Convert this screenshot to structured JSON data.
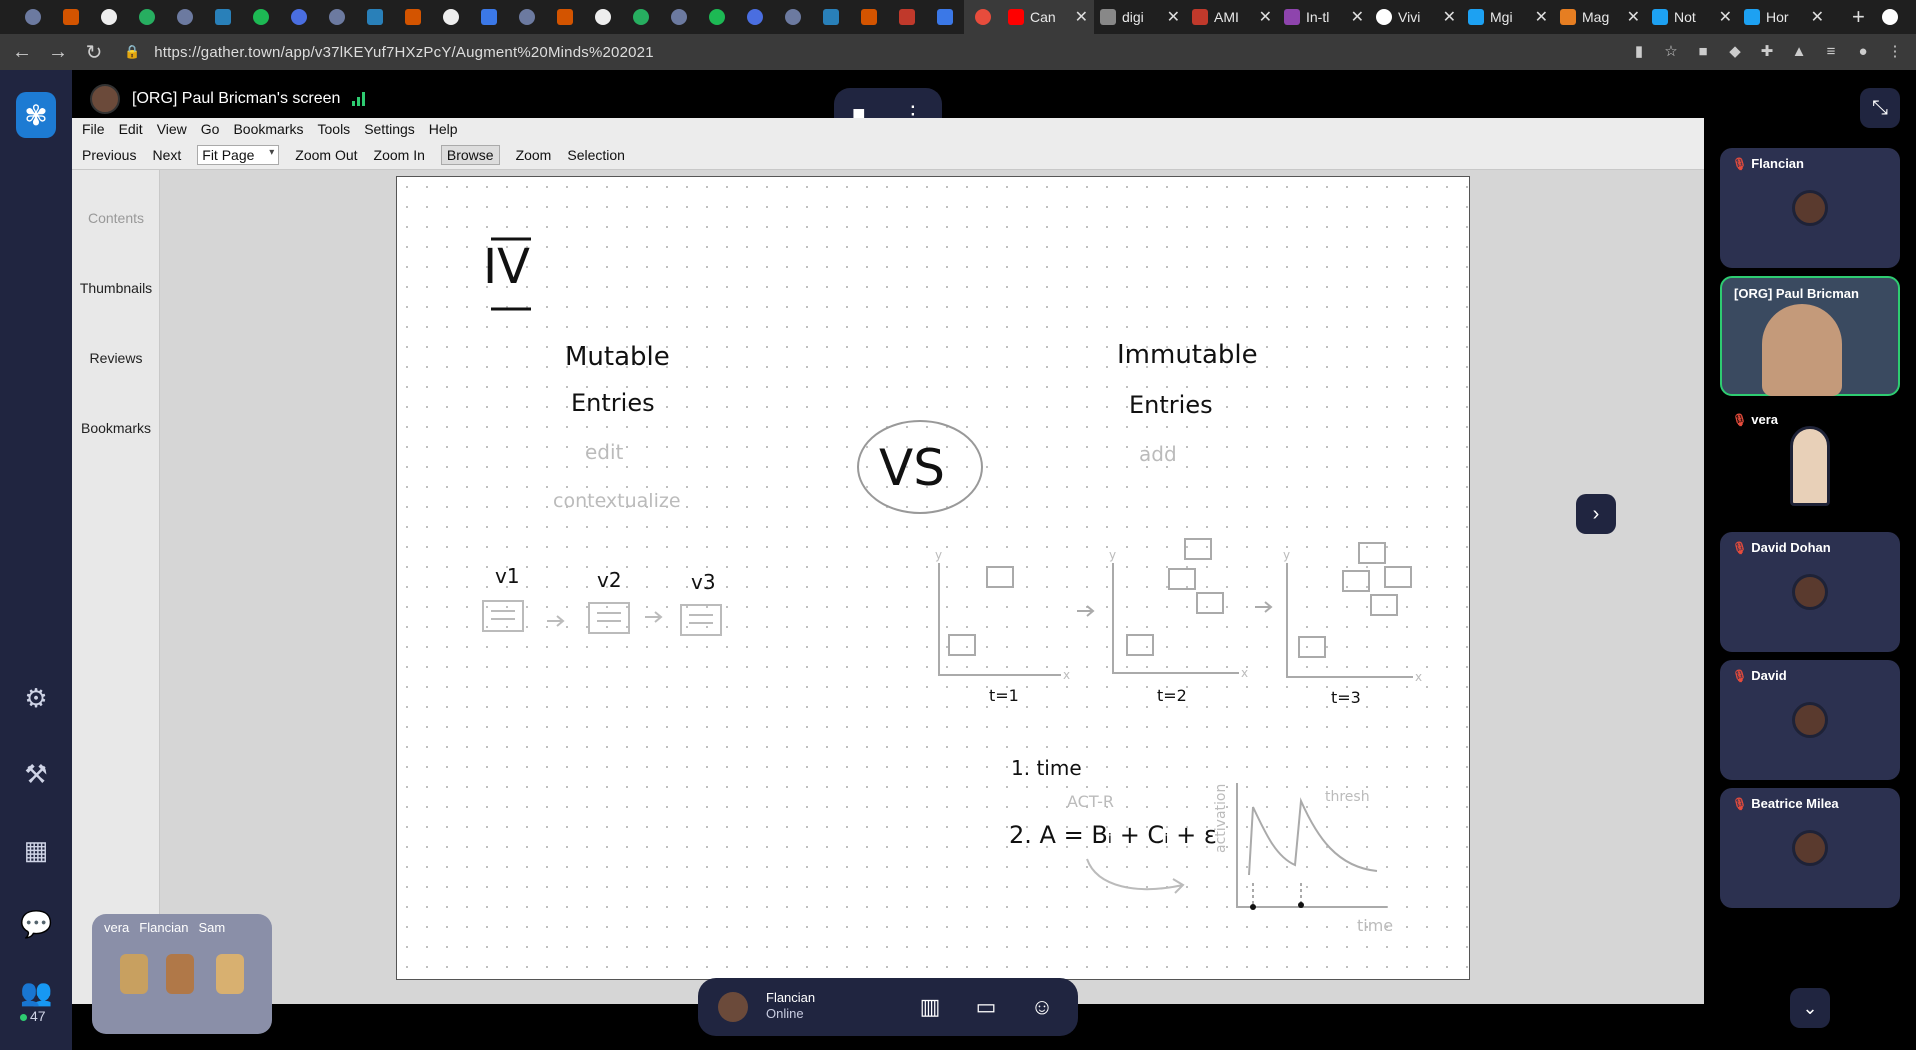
{
  "browser": {
    "tabs": [
      {
        "title": "Can",
        "color": "#ff0000"
      },
      {
        "title": "digi",
        "color": "#888888"
      },
      {
        "title": "AMI",
        "color": "#c0392b"
      },
      {
        "title": "In-tl",
        "color": "#8e44ad"
      },
      {
        "title": "Vivi",
        "color": "#ffffff"
      },
      {
        "title": "Mgi",
        "color": "#1da1f2"
      },
      {
        "title": "Mag",
        "color": "#e67e22"
      },
      {
        "title": "Not",
        "color": "#1da1f2"
      },
      {
        "title": "Hor",
        "color": "#1da1f2"
      }
    ],
    "url": "https://gather.town/app/v37lKEYuf7HXzPcY/Augment%20Minds%202021"
  },
  "share": {
    "title": "[ORG] Paul Bricman's screen"
  },
  "viewer": {
    "menu": [
      "File",
      "Edit",
      "View",
      "Go",
      "Bookmarks",
      "Tools",
      "Settings",
      "Help"
    ],
    "toolbar": {
      "previous": "Previous",
      "next": "Next",
      "fit": "Fit Page",
      "zoom_out": "Zoom Out",
      "zoom_in": "Zoom In",
      "browse": "Browse",
      "zoom": "Zoom",
      "selection": "Selection"
    },
    "side": {
      "contents": "Contents",
      "thumbnails": "Thumbnails",
      "reviews": "Reviews",
      "bookmarks": "Bookmarks"
    },
    "page": {
      "heading": "IV",
      "mutable_1": "Mutable",
      "mutable_2": "Entries",
      "edit": "edit",
      "contextualize": "contextualize",
      "vs": "VS",
      "immutable_1": "Immutable",
      "immutable_2": "Entries",
      "add": "add",
      "v1": "v1",
      "v2": "v2",
      "v3": "v3",
      "t1": "t=1",
      "t2": "t=2",
      "t3": "t=3",
      "axis_y": "y",
      "axis_x": "x",
      "item1": "1. time",
      "actr": "ACT-R",
      "item2": "2. A = Bᵢ + Cᵢ + ε",
      "activation": "activation",
      "thresh": "thresh",
      "time": "time"
    }
  },
  "participants": [
    {
      "name": "Flancian",
      "muted": true
    },
    {
      "name": "[ORG] Paul Bricman",
      "muted": false
    },
    {
      "name": "vera",
      "muted": true
    },
    {
      "name": "David Dohan",
      "muted": true
    },
    {
      "name": "David",
      "muted": true
    },
    {
      "name": "Beatrice Milea",
      "muted": true
    }
  ],
  "minimap": {
    "names": [
      "vera",
      "Flancian",
      "Sam"
    ]
  },
  "online_count": "47",
  "me": {
    "name": "Flancian",
    "status": "Online"
  }
}
